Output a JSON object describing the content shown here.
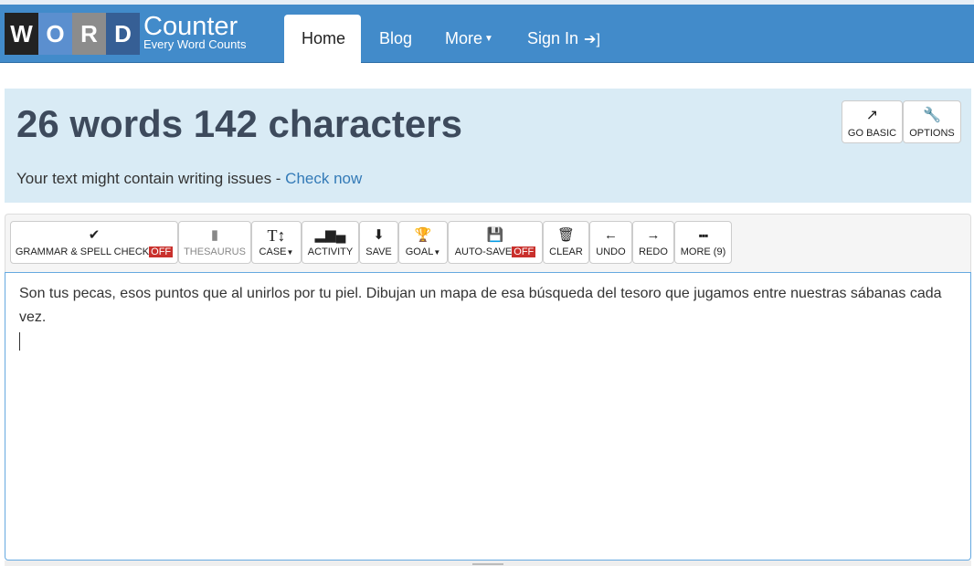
{
  "nav": {
    "logo_letters": [
      "W",
      "O",
      "R",
      "D"
    ],
    "logo_colors": [
      "#222222",
      "#5b8fcf",
      "#8c8c8c",
      "#365f95"
    ],
    "logo_title": "Counter",
    "logo_tagline": "Every Word Counts",
    "items": [
      {
        "label": "Home",
        "active": true
      },
      {
        "label": "Blog"
      },
      {
        "label": "More"
      },
      {
        "label": "Sign In"
      }
    ],
    "color": "#428bca"
  },
  "panel": {
    "counts": "26 words 142 characters",
    "issues_text": "Your text might contain writing issues - ",
    "issues_link": "Check now",
    "go_basic": "GO BASIC",
    "options": "OPTIONS"
  },
  "toolbar": {
    "off_badge": "OFF",
    "buttons": [
      {
        "label": "GRAMMAR & SPELL CHECK",
        "icon": "check-icon",
        "badge": "OFF"
      },
      {
        "label": "THESAURUS",
        "icon": "book-icon",
        "disabled": true
      },
      {
        "label": "CASE",
        "icon": "text-height-icon",
        "dropdown": true
      },
      {
        "label": "ACTIVITY",
        "icon": "bar-chart-icon"
      },
      {
        "label": "SAVE",
        "icon": "download-file-icon"
      },
      {
        "label": "GOAL",
        "icon": "trophy-icon",
        "dropdown": true
      },
      {
        "label": "AUTO-SAVE",
        "icon": "floppy-disk-icon",
        "badge": "OFF"
      },
      {
        "label": "CLEAR",
        "icon": "trash-icon"
      },
      {
        "label": "UNDO",
        "icon": "arrow-left-icon"
      },
      {
        "label": "REDO",
        "icon": "arrow-right-icon"
      },
      {
        "label": "MORE (9)",
        "icon": "grid-icon"
      }
    ]
  },
  "editor": {
    "text": "Son tus pecas, esos puntos que al unirlos por tu piel. Dibujan un mapa de esa búsqueda del tesoro que jugamos entre nuestras sábanas cada vez."
  }
}
